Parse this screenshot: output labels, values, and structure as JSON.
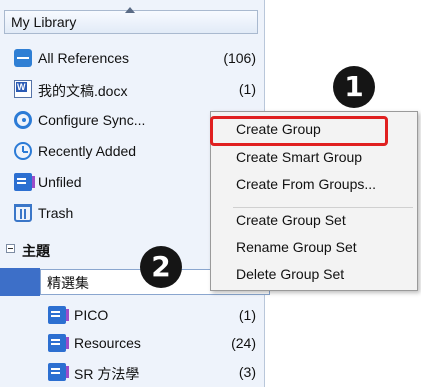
{
  "library": {
    "title": "My Library"
  },
  "items": [
    {
      "label": "All References",
      "count": "(106)",
      "icon": "all-references-icon"
    },
    {
      "label": "我的文稿.docx",
      "count": "(1)",
      "icon": "word-doc-icon"
    },
    {
      "label": "Configure Sync...",
      "count": "",
      "icon": "sync-icon"
    },
    {
      "label": "Recently Added",
      "count": "",
      "icon": "recently-added-icon"
    },
    {
      "label": "Unfiled",
      "count": "",
      "icon": "folder-icon"
    },
    {
      "label": "Trash",
      "count": "",
      "icon": "trash-icon"
    }
  ],
  "group_set": {
    "label": "主題"
  },
  "editing_group": {
    "value": "精選集"
  },
  "groups": [
    {
      "label": "PICO",
      "count": "(1)"
    },
    {
      "label": "Resources",
      "count": "(24)"
    },
    {
      "label": "SR 方法學",
      "count": "(3)"
    }
  ],
  "context_menu": {
    "items": [
      "Create Group",
      "Create Smart Group",
      "Create From Groups...",
      "Create Group Set",
      "Rename Group Set",
      "Delete Group Set"
    ],
    "highlighted": "Create Group"
  },
  "badges": {
    "one": "1",
    "two": "2"
  },
  "colors": {
    "highlight": "#e02020",
    "selection": "#3d6fc8"
  }
}
